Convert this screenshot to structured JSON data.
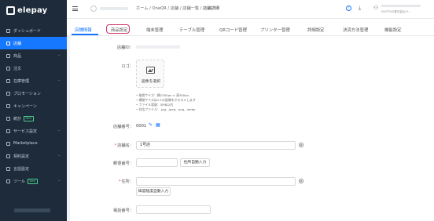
{
  "app": {
    "logo_text": "elepay"
  },
  "sidebar": {
    "items": [
      {
        "label": "ダッシュボード",
        "icon": "dashboard-icon",
        "active": false,
        "has_chevron": false
      },
      {
        "label": "店舗",
        "icon": "store-icon",
        "active": true,
        "has_chevron": false
      },
      {
        "label": "商品",
        "icon": "product-icon",
        "active": false,
        "has_chevron": true
      },
      {
        "label": "注文",
        "icon": "order-icon",
        "active": false,
        "has_chevron": false
      },
      {
        "label": "在庫管理",
        "icon": "inventory-icon",
        "active": false,
        "has_chevron": true
      },
      {
        "label": "プロモーション",
        "icon": "promotion-icon",
        "active": false,
        "has_chevron": false
      },
      {
        "label": "キャンペーン",
        "icon": "campaign-icon",
        "active": false,
        "has_chevron": false
      },
      {
        "label": "統計",
        "icon": "stats-icon",
        "active": false,
        "has_chevron": false,
        "badge": "New"
      },
      {
        "label": "サービス設定",
        "icon": "service-settings-icon",
        "active": false,
        "has_chevron": true
      },
      {
        "label": "Marketplace",
        "icon": "marketplace-icon",
        "active": false,
        "has_chevron": false
      },
      {
        "label": "契約設定",
        "icon": "contract-icon",
        "active": false,
        "has_chevron": true
      },
      {
        "label": "言語設定",
        "icon": "language-icon",
        "active": false,
        "has_chevron": false
      },
      {
        "label": "ツール",
        "icon": "tool-icon",
        "active": false,
        "has_chevron": true,
        "badge": "New"
      }
    ]
  },
  "header": {
    "breadcrumb": [
      "ホーム",
      "OneQR",
      "店舗",
      "店舗一覧",
      "店舗詳細"
    ],
    "separator": "/",
    "user_org": "ELESTYLE株式会社(テ..."
  },
  "tabs": [
    {
      "label": "店舗情報",
      "active": true
    },
    {
      "label": "商品設定",
      "active": false,
      "highlighted": true
    },
    {
      "label": "端末管理",
      "active": false
    },
    {
      "label": "テーブル管理",
      "active": false
    },
    {
      "label": "QRコード管理",
      "active": false
    },
    {
      "label": "プリンター管理",
      "active": false
    },
    {
      "label": "詳細設定",
      "active": false
    },
    {
      "label": "決済方法管理",
      "active": false
    },
    {
      "label": "機能設定",
      "active": false
    }
  ],
  "form": {
    "store_id_label": "店舗ID：",
    "logo_label": "ロゴ：",
    "upload_label": "画像を選択",
    "logo_notes": [
      "推奨サイズ：横2300px × 高300px",
      "横縦サイズは1:1の画像をオススメします",
      "ファイル容量：5MB以内",
      "対応ファイル：.jpg, .jpeg, .png, .webp"
    ],
    "store_number_label": "店舗番号：",
    "store_number_value": "0001",
    "store_name_label": "店舗名：",
    "store_name_value": "1号店",
    "postal_label": "郵便番号：",
    "postal_button": "住所自動入力",
    "address_label": "住所：",
    "latlng_button": "緯度経度自動入力",
    "phone_label": "電話番号："
  },
  "colors": {
    "sidebar_bg": "#1d2b3a",
    "accent": "#1677ff",
    "highlight_ring": "#d0346b",
    "required": "#e34d59"
  }
}
